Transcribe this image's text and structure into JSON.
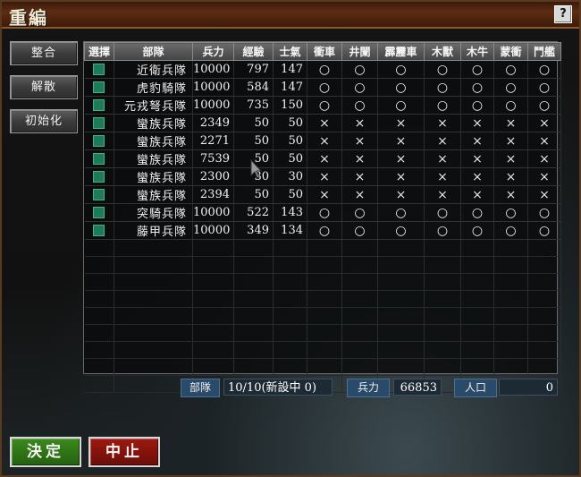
{
  "window": {
    "title": "重編",
    "help": "?"
  },
  "side_buttons": [
    {
      "label": "整合"
    },
    {
      "label": "解散"
    },
    {
      "label": "初始化"
    }
  ],
  "table": {
    "headers": [
      "選擇",
      "部隊",
      "兵力",
      "經驗",
      "士氣",
      "衝車",
      "井闌",
      "霹靂車",
      "木獸",
      "木牛",
      "蒙衝",
      "鬥艦"
    ],
    "rows": [
      {
        "name": "近衛兵隊",
        "troops": "10000",
        "exp": "797",
        "morale": "147",
        "marks": [
          "○",
          "○",
          "○",
          "○",
          "○",
          "○",
          "○"
        ]
      },
      {
        "name": "虎豹騎隊",
        "troops": "10000",
        "exp": "584",
        "morale": "147",
        "marks": [
          "○",
          "○",
          "○",
          "○",
          "○",
          "○",
          "○"
        ]
      },
      {
        "name": "元戎弩兵隊",
        "troops": "10000",
        "exp": "735",
        "morale": "150",
        "marks": [
          "○",
          "○",
          "○",
          "○",
          "○",
          "○",
          "○"
        ]
      },
      {
        "name": "蠻族兵隊",
        "troops": "2349",
        "exp": "50",
        "morale": "50",
        "marks": [
          "×",
          "×",
          "×",
          "×",
          "×",
          "×",
          "×"
        ]
      },
      {
        "name": "蠻族兵隊",
        "troops": "2271",
        "exp": "50",
        "morale": "50",
        "marks": [
          "×",
          "×",
          "×",
          "×",
          "×",
          "×",
          "×"
        ]
      },
      {
        "name": "蠻族兵隊",
        "troops": "7539",
        "exp": "50",
        "morale": "50",
        "marks": [
          "×",
          "×",
          "×",
          "×",
          "×",
          "×",
          "×"
        ]
      },
      {
        "name": "蠻族兵隊",
        "troops": "2300",
        "exp": "30",
        "morale": "30",
        "marks": [
          "×",
          "×",
          "×",
          "×",
          "×",
          "×",
          "×"
        ]
      },
      {
        "name": "蠻族兵隊",
        "troops": "2394",
        "exp": "50",
        "morale": "50",
        "marks": [
          "×",
          "×",
          "×",
          "×",
          "×",
          "×",
          "×"
        ]
      },
      {
        "name": "突騎兵隊",
        "troops": "10000",
        "exp": "522",
        "morale": "143",
        "marks": [
          "○",
          "○",
          "○",
          "○",
          "○",
          "○",
          "○"
        ]
      },
      {
        "name": "藤甲兵隊",
        "troops": "10000",
        "exp": "349",
        "morale": "134",
        "marks": [
          "○",
          "○",
          "○",
          "○",
          "○",
          "○",
          "○"
        ]
      }
    ]
  },
  "stats": {
    "units_label": "部隊",
    "units_value": "10/10(新設中 0)",
    "troops_label": "兵力",
    "troops_value": "66853",
    "population_label": "人口",
    "population_value": "0"
  },
  "buttons": {
    "ok": "決定",
    "cancel": "中止"
  },
  "colors": {
    "title_bar": "#5c2c12",
    "checkbox": "#1f7a5a",
    "stat_label": "#2a4a6a",
    "ok": "#3c8a1f",
    "cancel": "#9c1a10"
  }
}
